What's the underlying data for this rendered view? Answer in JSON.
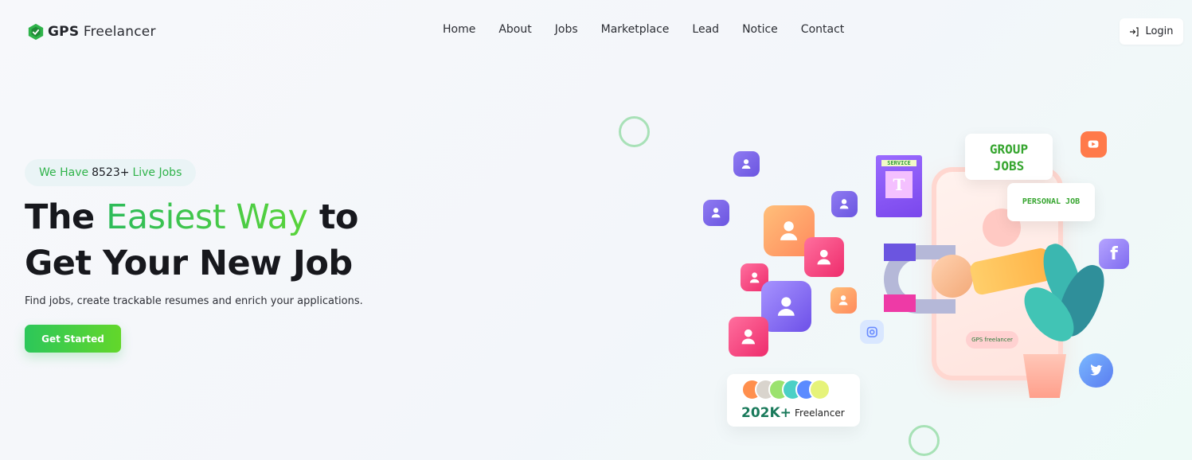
{
  "brand": {
    "name_bold": "GPS",
    "name_rest": " Freelancer"
  },
  "nav": {
    "items": [
      {
        "label": "Home"
      },
      {
        "label": "About"
      },
      {
        "label": "Jobs"
      },
      {
        "label": "Marketplace"
      },
      {
        "label": "Lead"
      },
      {
        "label": "Notice"
      },
      {
        "label": "Contact"
      }
    ],
    "login_label": "Login"
  },
  "hero": {
    "badge_prefix": "We Have",
    "badge_count": "8523+",
    "badge_suffix": "Live Jobs",
    "headline_part1": "The ",
    "headline_highlight": "Easiest Way",
    "headline_part2": " to",
    "headline_line2": "Get Your New Job",
    "subtext": "Find jobs, create trackable resumes and enrich your applications.",
    "cta_label": "Get Started"
  },
  "illustration": {
    "service_label": "SERVICE",
    "group_jobs_line1": "GROUP",
    "group_jobs_line2": "JOBS",
    "personal_job": "PERSONAL JOB",
    "phone_brand": "GPS freelancer"
  },
  "freelancers": {
    "count": "202K+",
    "label": "Freelancer"
  },
  "colors": {
    "accent": "#2fb34a",
    "cta_start": "#2cc75a",
    "cta_end": "#63d72a",
    "count_color": "#1a7a5b"
  }
}
